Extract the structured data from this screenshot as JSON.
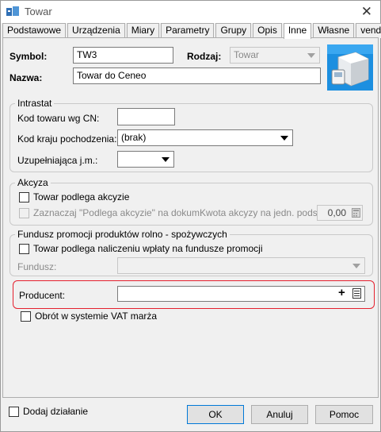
{
  "window": {
    "title": "Towar"
  },
  "tabs": [
    "Podstawowe",
    "Urządzenia",
    "Miary",
    "Parametry",
    "Grupy",
    "Opis",
    "Inne",
    "Własne",
    "vendero"
  ],
  "active_tab": "Inne",
  "header": {
    "symbol_label": "Symbol:",
    "symbol_value": "TW3",
    "rodzaj_label": "Rodzaj:",
    "rodzaj_value": "Towar",
    "nazwa_label": "Nazwa:",
    "nazwa_value": "Towar do Ceneo"
  },
  "intrastat": {
    "title": "Intrastat",
    "kod_cn_label": "Kod towaru wg CN:",
    "kod_cn_value": "",
    "kraj_label": "Kod kraju pochodzenia:",
    "kraj_value": "(brak)",
    "jm_label": "Uzupełniająca j.m.:",
    "jm_value": ""
  },
  "akcyza": {
    "title": "Akcyza",
    "podlega_label": "Towar podlega akcyzie",
    "zaznaczaj_label": "Zaznaczaj \"Podlega akcyzie\" na dokum.",
    "kwota_label": "Kwota akcyzy na jedn. podst.",
    "kwota_value": "0,00"
  },
  "fundusz": {
    "title": "Fundusz promocji produktów rolno - spożywczych",
    "podlega_label": "Towar podlega naliczeniu wpłaty na fundusze promocji",
    "fundusz_label": "Fundusz:",
    "fundusz_value": ""
  },
  "producent": {
    "label": "Producent:",
    "value": "",
    "add_glyph": "+"
  },
  "vat_marza": {
    "label": "Obrót w systemie VAT marża"
  },
  "footer": {
    "dodaj_label": "Dodaj działanie",
    "ok_label": "OK",
    "anuluj_label": "Anuluj",
    "pomoc_label": "Pomoc"
  },
  "colors": {
    "highlight": "#e5202e",
    "default_button_border": "#0078d7"
  }
}
